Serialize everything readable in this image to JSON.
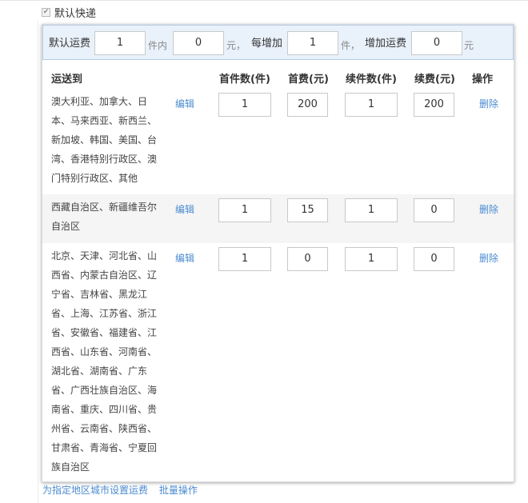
{
  "default_express": {
    "checked": true,
    "label": "默认快递"
  },
  "default_fee": {
    "label_first": "默认运费",
    "first_count": "1",
    "unit_pieces_within": "件内",
    "first_fee": "0",
    "unit_yuan": "元，",
    "label_each_add": "每增加",
    "add_count": "1",
    "unit_piece_comma": "件，",
    "label_add_fee": "增加运费",
    "add_fee": "0",
    "unit_yuan_end": "元"
  },
  "table": {
    "headers": {
      "region": "运送到",
      "first_count": "首件数(件)",
      "first_fee": "首费(元)",
      "add_count": "续件数(件)",
      "add_fee": "续费(元)",
      "action": "操作"
    },
    "edit_label": "编辑",
    "delete_label": "删除",
    "rows": [
      {
        "region": "澳大利亚、加拿大、日本、马来西亚、新西兰、新加坡、韩国、美国、台湾、香港特别行政区、澳门特别行政区、其他",
        "first_count": "1",
        "first_fee": "200",
        "add_count": "1",
        "add_fee": "200"
      },
      {
        "region": "西藏自治区、新疆维吾尔自治区",
        "first_count": "1",
        "first_fee": "15",
        "add_count": "1",
        "add_fee": "0"
      },
      {
        "region": "北京、天津、河北省、山西省、内蒙古自治区、辽宁省、吉林省、黑龙江省、上海、江苏省、浙江省、安徽省、福建省、江西省、山东省、河南省、湖北省、湖南省、广东省、广西壮族自治区、海南省、重庆、四川省、贵州省、云南省、陕西省、甘肃省、青海省、宁夏回族自治区",
        "first_count": "1",
        "first_fee": "0",
        "add_count": "1",
        "add_fee": "0"
      }
    ]
  },
  "links": {
    "set_region_fee": "为指定地区城市设置运费",
    "batch": "批量操作"
  }
}
